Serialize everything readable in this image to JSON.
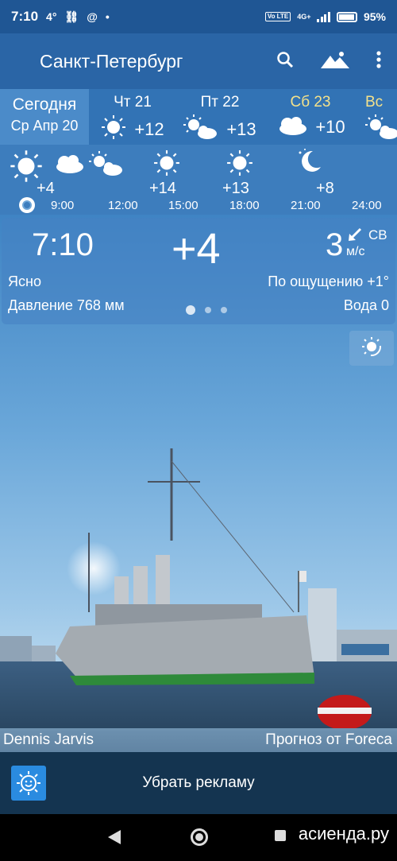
{
  "status_bar": {
    "time": "7:10",
    "left_extra": "4°",
    "network": "4G+",
    "volte": "Vo LTE",
    "battery": "95%"
  },
  "app_bar": {
    "city": "Санкт-Петербург",
    "icons": [
      "search-icon",
      "landscape-icon",
      "more-vert-icon"
    ]
  },
  "days": [
    {
      "name": "Сегодня",
      "date": "Ср Апр 20"
    },
    {
      "name": "Чт 21",
      "temp": "+12",
      "icon": "sun"
    },
    {
      "name": "Пт 22",
      "temp": "+13",
      "icon": "sun-cloud"
    },
    {
      "name": "Сб 23",
      "temp": "+10",
      "icon": "cloud"
    },
    {
      "name": "Вс",
      "temp": "",
      "icon": "sun-cloud"
    }
  ],
  "hourly": [
    {
      "time": "9:00",
      "temp": "+4",
      "icon": "sun"
    },
    {
      "time": "12:00",
      "temp": "",
      "icon": "cloud"
    },
    {
      "time": "15:00",
      "temp": "+14",
      "icon": "sun"
    },
    {
      "time": "18:00",
      "temp": "+13",
      "icon": "sun"
    },
    {
      "time": "21:00",
      "temp": "+8",
      "icon": "moon"
    },
    {
      "time": "24:00",
      "temp": "",
      "icon": ""
    }
  ],
  "current": {
    "time": "7:10",
    "temp": "+4",
    "wind_speed": "3",
    "wind_dir": "СВ",
    "wind_unit": "м/с",
    "condition": "Ясно",
    "feels_like": "По ощущению +1°",
    "pressure": "Давление 768 мм",
    "water": "Вода 0"
  },
  "photo": {
    "credit_left": "Dennis Jarvis",
    "credit_right": "Прогноз от Foreca"
  },
  "ad": {
    "label": "Убрать рекламу"
  },
  "watermark": "асиенда.ру",
  "colors": {
    "appbar": "#2a65a6",
    "sky_top": "#2d6cb0",
    "ad_bg": "#143450",
    "saturday": "#f5e28a"
  }
}
